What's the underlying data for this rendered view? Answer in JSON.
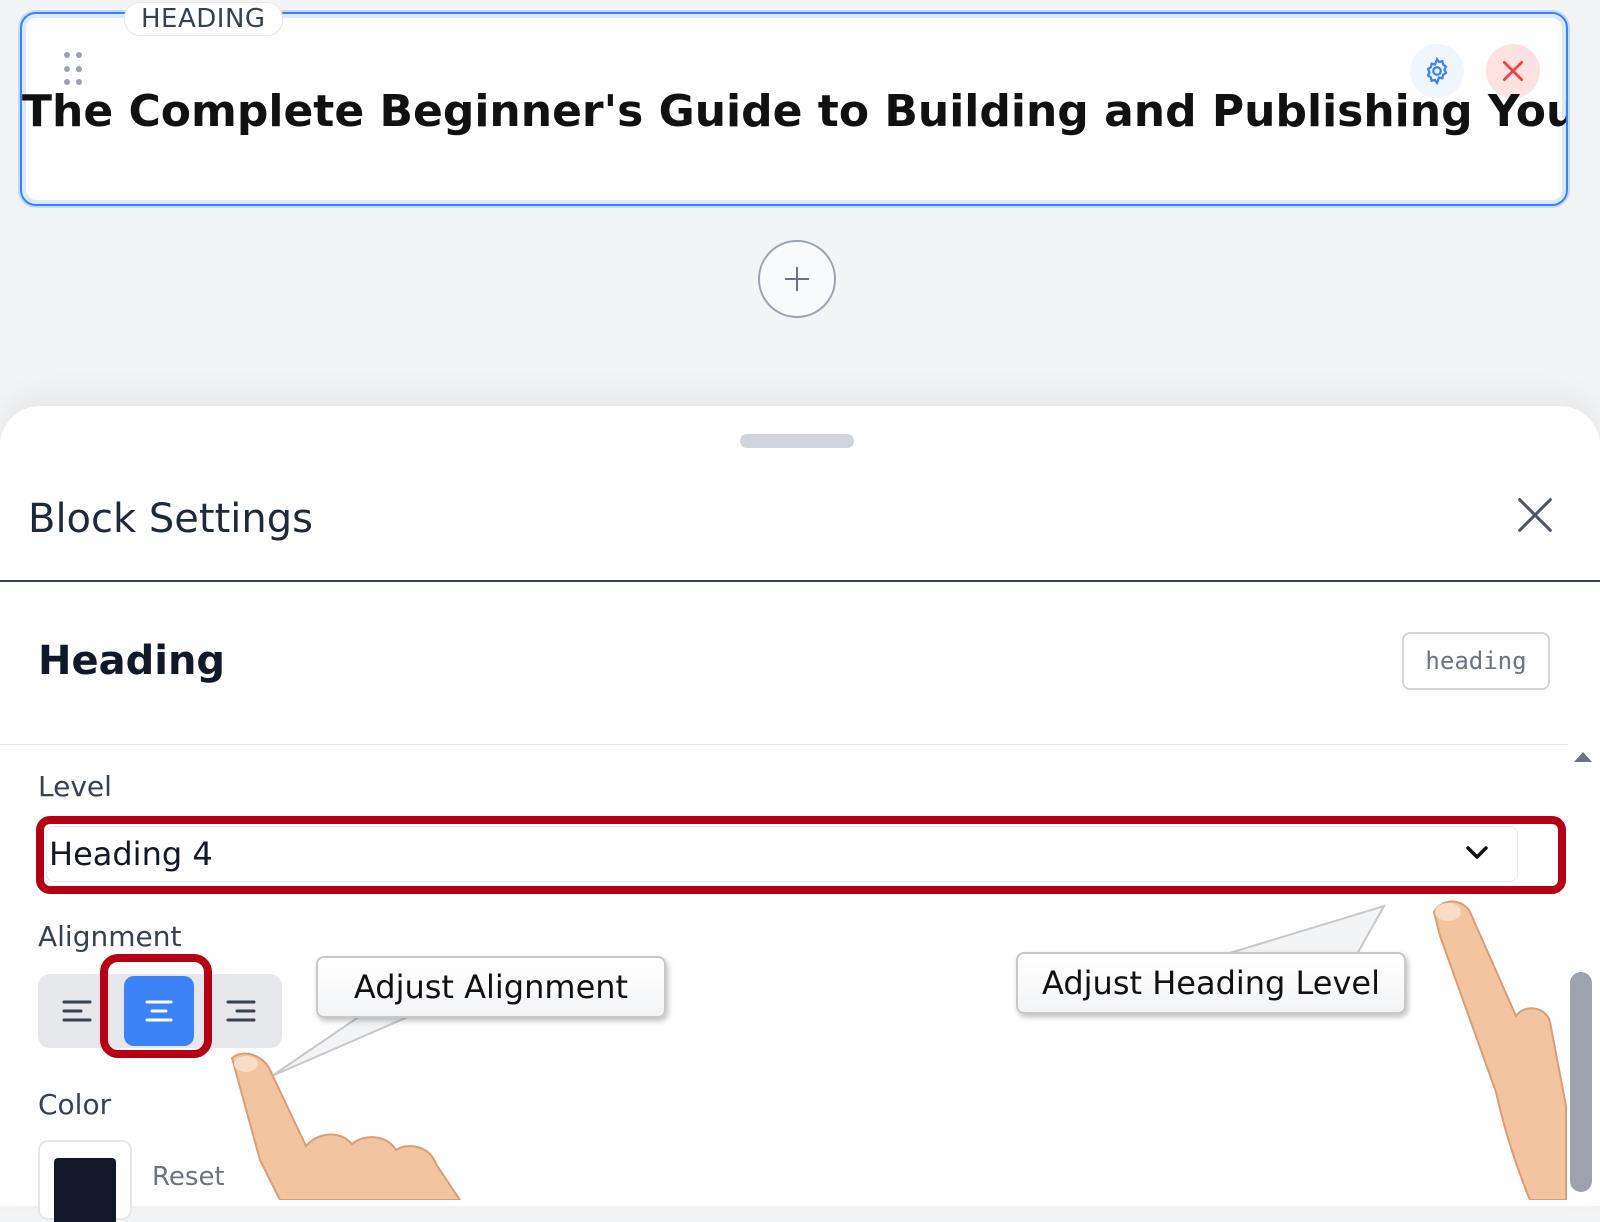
{
  "block": {
    "tag": "HEADING",
    "title": "The Complete Beginner's Guide to Building and Publishing Your",
    "icons": [
      "drag-handle-icon",
      "settings-gear-icon",
      "delete-x-icon",
      "add-plus-icon"
    ]
  },
  "sheet": {
    "title": "Block Settings",
    "close_icon": "close-x-icon",
    "section_title": "Heading",
    "type_badge": "heading",
    "level": {
      "label": "Level",
      "selected": "Heading 4"
    },
    "alignment": {
      "label": "Alignment",
      "options": [
        "left",
        "center",
        "right"
      ],
      "selected": "center"
    },
    "color": {
      "label": "Color",
      "value": "#111827",
      "reset_label": "Reset"
    }
  },
  "annotations": {
    "alignment_callout": "Adjust Alignment",
    "level_callout": "Adjust Heading Level"
  },
  "colors": {
    "accent": "#3b82f6",
    "highlight": "#b30012",
    "delete": "#ef4444"
  }
}
